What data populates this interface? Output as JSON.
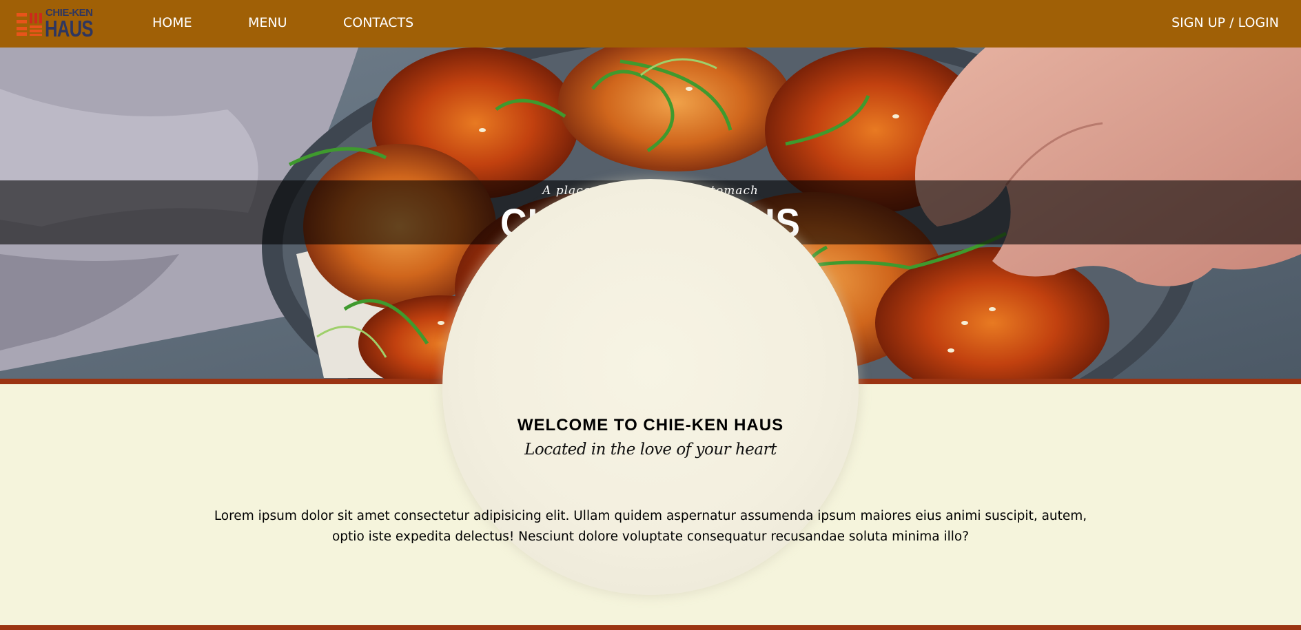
{
  "brand": {
    "logo_line1": "CHIE-KEN",
    "logo_line2": "HAUS"
  },
  "nav": {
    "items": [
      {
        "label": "HOME"
      },
      {
        "label": "MENU"
      },
      {
        "label": "CONTACTS"
      }
    ],
    "login_label": "SIGN UP / LOGIN"
  },
  "hero": {
    "tagline": "A place for your hungry stomach",
    "title": "CHIE-KEN HAUS"
  },
  "welcome": {
    "title": "WELCOME TO CHIE-KEN HAUS",
    "subtitle": "Located in the love of your heart",
    "body": "Lorem ipsum dolor sit amet consectetur adipisicing elit. Ullam quidem aspernatur assumenda ipsum maiores eius animi suscipit, autem, optio iste expedita delectus! Nesciunt dolore voluptate consequatur recusandae soluta minima illo?"
  },
  "colors": {
    "navbar": "#a06006",
    "accent_line": "#9b3412",
    "page_background": "#f5f4dc",
    "logo_text": "#2e3660",
    "logo_mark": "#e8541a"
  }
}
